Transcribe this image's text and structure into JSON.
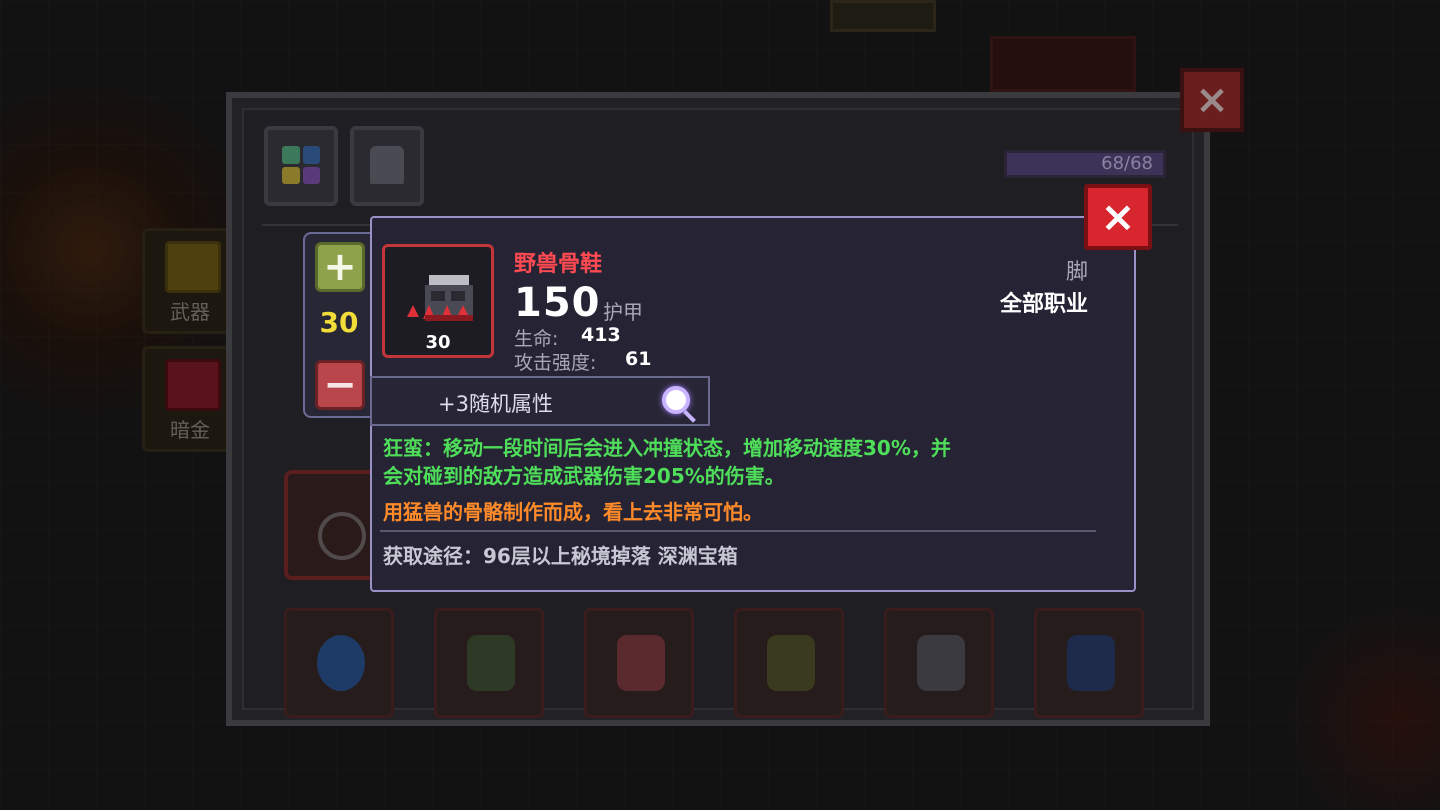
{
  "side_tabs": [
    {
      "label": "武器"
    },
    {
      "label": "暗金"
    }
  ],
  "inventory": {
    "capacity_text": "68/68",
    "filled_fraction": 1.0
  },
  "stepper": {
    "plus": "+",
    "quantity": "30",
    "minus": "−"
  },
  "item": {
    "name": "野兽骨鞋",
    "level": "30",
    "armor_value": "150",
    "armor_label": "护甲",
    "stats": [
      {
        "label": "生命:",
        "value": "413"
      },
      {
        "label": "攻击强度:",
        "value": "61"
      }
    ],
    "slot": "脚",
    "class": "全部职业",
    "random_attrs": "+3随机属性",
    "effect_line1": "狂蛮：移动一段时间后会进入冲撞状态，增加移动速度30%，并",
    "effect_line2": "会对碰到的敌方造成武器伤害205%的伤害。",
    "flavor": "用猛兽的骨骼制作而成，看上去非常可怕。",
    "source": "获取途径：96层以上秘境掉落 深渊宝箱"
  },
  "colors": {
    "name": "#ff4a52",
    "effect": "#4ede5a",
    "flavor": "#ff8a2a",
    "quantity": "#f2dc3a",
    "close": "#d8262e"
  },
  "icons": {
    "close": "×",
    "search": "magnifier-icon"
  }
}
